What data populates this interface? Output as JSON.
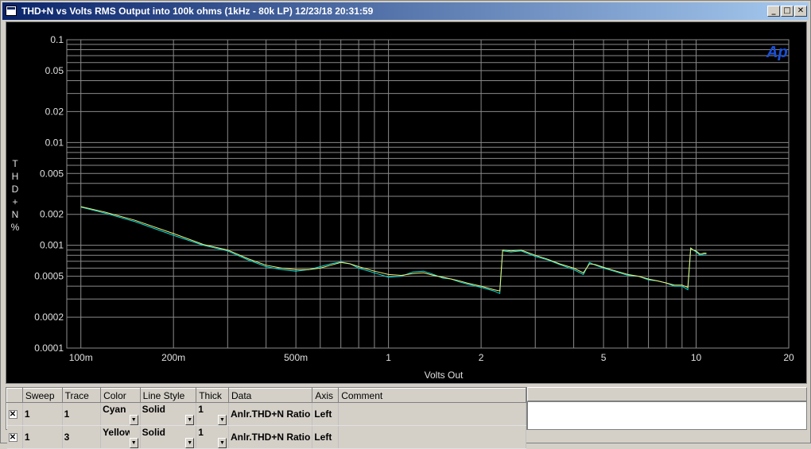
{
  "window": {
    "title": "THD+N vs Volts RMS Output into 100k ohms (1kHz - 80k LP)  12/23/18 20:31:59",
    "minimize_glyph": "_",
    "maximize_glyph": "□",
    "close_glyph": "✕"
  },
  "logo": "Ap",
  "chart_data": {
    "type": "line",
    "xlabel": "Volts Out",
    "ylabel": "THD+N %",
    "ylabel_letters": [
      "T",
      "H",
      "D",
      "+",
      "N",
      "%"
    ],
    "xscale": "log",
    "yscale": "log",
    "xlim": [
      0.09,
      20
    ],
    "ylim": [
      0.0001,
      0.1
    ],
    "grid": true,
    "xticks": [
      {
        "v": 0.1,
        "label": "100m"
      },
      {
        "v": 0.2,
        "label": "200m"
      },
      {
        "v": 0.5,
        "label": "500m"
      },
      {
        "v": 1,
        "label": "1"
      },
      {
        "v": 2,
        "label": "2"
      },
      {
        "v": 5,
        "label": "5"
      },
      {
        "v": 10,
        "label": "10"
      },
      {
        "v": 20,
        "label": "20"
      }
    ],
    "yticks": [
      {
        "v": 0.1,
        "label": "0.1"
      },
      {
        "v": 0.05,
        "label": "0.05"
      },
      {
        "v": 0.02,
        "label": "0.02"
      },
      {
        "v": 0.01,
        "label": "0.01"
      },
      {
        "v": 0.005,
        "label": "0.005"
      },
      {
        "v": 0.002,
        "label": "0.002"
      },
      {
        "v": 0.001,
        "label": "0.001"
      },
      {
        "v": 0.0005,
        "label": "0.0005"
      },
      {
        "v": 0.0002,
        "label": "0.0002"
      },
      {
        "v": 0.0001,
        "label": "0.0001"
      }
    ],
    "series": [
      {
        "color": "#00e0e0",
        "x": [
          0.1,
          0.12,
          0.15,
          0.2,
          0.25,
          0.3,
          0.35,
          0.4,
          0.45,
          0.5,
          0.55,
          0.6,
          0.65,
          0.7,
          0.75,
          0.8,
          0.9,
          1.0,
          1.1,
          1.2,
          1.3,
          1.4,
          1.5,
          1.6,
          1.7,
          1.8,
          2.0,
          2.2,
          2.3,
          2.35,
          2.5,
          2.7,
          3.0,
          3.3,
          3.6,
          4.0,
          4.3,
          4.5,
          4.7,
          5.0,
          5.5,
          6.0,
          6.5,
          7.0,
          7.5,
          8.0,
          8.5,
          9.0,
          9.4,
          9.6,
          9.8,
          10.0,
          10.3,
          10.6,
          10.8
        ],
        "y": [
          0.00235,
          0.00205,
          0.0017,
          0.00125,
          0.001,
          0.00088,
          0.00072,
          0.00062,
          0.00058,
          0.00056,
          0.00058,
          0.00062,
          0.00066,
          0.00069,
          0.00066,
          0.0006,
          0.00054,
          0.00049,
          0.0005,
          0.00055,
          0.00056,
          0.00052,
          0.00048,
          0.00047,
          0.00044,
          0.00042,
          0.00039,
          0.00036,
          0.00034,
          0.00088,
          0.00086,
          0.00088,
          0.00078,
          0.00072,
          0.00065,
          0.00058,
          0.00052,
          0.00068,
          0.00064,
          0.0006,
          0.00055,
          0.00051,
          0.0005,
          0.00046,
          0.00045,
          0.00043,
          0.0004,
          0.0004,
          0.00037,
          0.00092,
          0.0009,
          0.00086,
          0.0008,
          0.00082,
          0.00082
        ]
      },
      {
        "color": "#f0f070",
        "x": [
          0.1,
          0.12,
          0.15,
          0.2,
          0.25,
          0.3,
          0.35,
          0.4,
          0.45,
          0.5,
          0.55,
          0.6,
          0.65,
          0.7,
          0.75,
          0.8,
          0.9,
          1.0,
          1.1,
          1.2,
          1.3,
          1.4,
          1.5,
          1.6,
          1.7,
          1.8,
          2.0,
          2.2,
          2.3,
          2.35,
          2.5,
          2.7,
          3.0,
          3.3,
          3.6,
          4.0,
          4.3,
          4.5,
          4.7,
          5.0,
          5.5,
          6.0,
          6.5,
          7.0,
          7.5,
          8.0,
          8.5,
          9.0,
          9.4,
          9.6,
          9.8,
          10.0,
          10.3,
          10.6,
          10.8
        ],
        "y": [
          0.00238,
          0.0021,
          0.00175,
          0.0013,
          0.00102,
          0.0009,
          0.00074,
          0.00064,
          0.0006,
          0.00058,
          0.00058,
          0.0006,
          0.00064,
          0.00068,
          0.00066,
          0.00062,
          0.00056,
          0.00052,
          0.00051,
          0.00053,
          0.00054,
          0.00051,
          0.00049,
          0.00047,
          0.00045,
          0.00043,
          0.0004,
          0.00037,
          0.00036,
          0.0009,
          0.00088,
          0.0009,
          0.0008,
          0.00073,
          0.00066,
          0.0006,
          0.00054,
          0.00066,
          0.00065,
          0.00061,
          0.00056,
          0.00052,
          0.0005,
          0.00047,
          0.00045,
          0.00043,
          0.00041,
          0.00041,
          0.00039,
          0.00094,
          0.0009,
          0.00088,
          0.00082,
          0.00084,
          0.00084
        ]
      }
    ]
  },
  "table": {
    "headers": [
      "Sweep",
      "Trace",
      "Color",
      "Line Style",
      "Thick",
      "Data",
      "Axis",
      "Comment"
    ],
    "check_glyph": "✕",
    "dd_glyph": "▼",
    "rows": [
      {
        "sweep": "1",
        "trace": "1",
        "color": "Cyan",
        "style": "Solid",
        "thick": "1",
        "data": "Anlr.THD+N Ratio",
        "axis": "Left",
        "comment": ""
      },
      {
        "sweep": "1",
        "trace": "3",
        "color": "Yellow",
        "style": "Solid",
        "thick": "1",
        "data": "Anlr.THD+N Ratio",
        "axis": "Left",
        "comment": ""
      }
    ]
  }
}
